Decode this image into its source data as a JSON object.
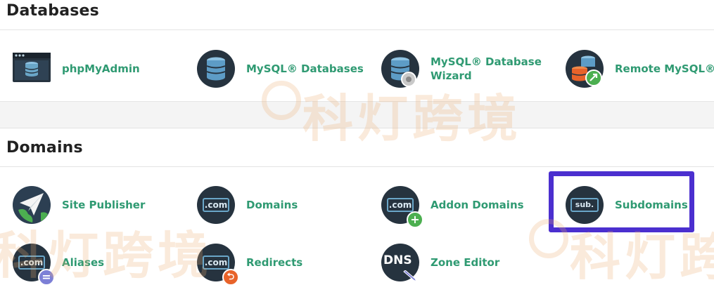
{
  "sections": {
    "databases": {
      "title": "Databases",
      "items": [
        {
          "label": "phpMyAdmin",
          "icon": "phpmyadmin-icon"
        },
        {
          "label": "MySQL® Databases",
          "icon": "database-stack-icon"
        },
        {
          "label": "MySQL® Database Wizard",
          "icon": "database-wizard-icon"
        },
        {
          "label": "Remote MySQL®",
          "icon": "remote-mysql-icon"
        }
      ]
    },
    "domains": {
      "title": "Domains",
      "items": [
        {
          "label": "Site Publisher",
          "icon": "paper-plane-globe-icon"
        },
        {
          "label": "Domains",
          "icon": "dotcom-icon",
          "icon_text": ".com"
        },
        {
          "label": "Addon Domains",
          "icon": "dotcom-add-icon",
          "icon_text": ".com"
        },
        {
          "label": "Subdomains",
          "icon": "subdomain-icon",
          "icon_text": "sub."
        },
        {
          "label": "Aliases",
          "icon": "dotcom-alias-icon",
          "icon_text": ".com"
        },
        {
          "label": "Redirects",
          "icon": "dotcom-redirect-icon",
          "icon_text": ".com"
        },
        {
          "label": "Zone Editor",
          "icon": "dns-zone-icon",
          "icon_text": "DNS"
        }
      ]
    }
  },
  "highlight": {
    "target": "Subdomains",
    "color": "#4b2fcf"
  },
  "watermark": {
    "text": "科灯跨境"
  },
  "colors": {
    "link": "#2f9a72",
    "icon_bg": "#26333f",
    "badge_green": "#4caf50",
    "badge_orange": "#e8632a",
    "badge_purple": "#7c7fd6"
  }
}
